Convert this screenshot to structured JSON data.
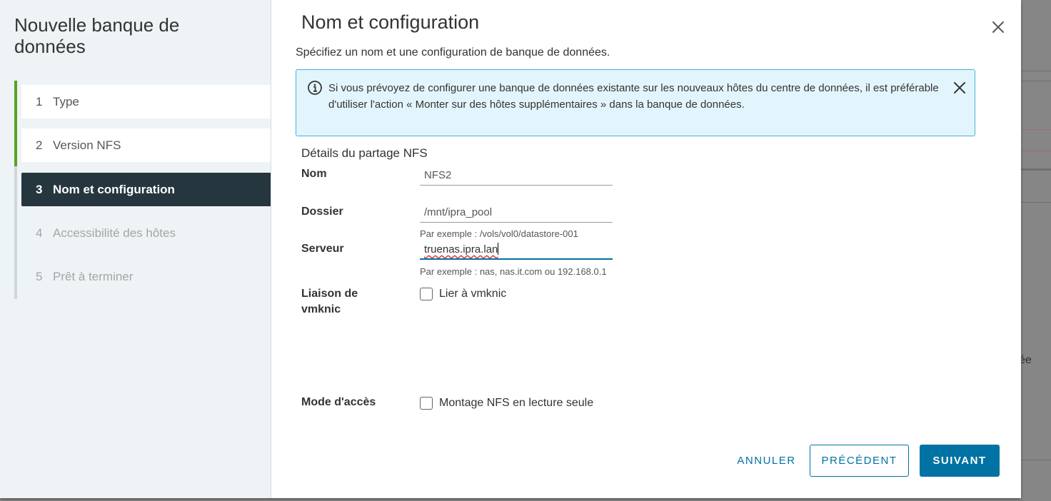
{
  "wizard": {
    "title": "Nouvelle banque de données",
    "steps": [
      {
        "num": "1",
        "label": "Type",
        "state": "done"
      },
      {
        "num": "2",
        "label": "Version NFS",
        "state": "done"
      },
      {
        "num": "3",
        "label": "Nom et configuration",
        "state": "current"
      },
      {
        "num": "4",
        "label": "Accessibilité des hôtes",
        "state": "todo"
      },
      {
        "num": "5",
        "label": "Prêt à terminer",
        "state": "todo"
      }
    ]
  },
  "main": {
    "title": "Nom et configuration",
    "subtitle": "Spécifiez un nom et une configuration de banque de données.",
    "alert": {
      "text": "Si vous prévoyez de configurer une banque de données existante sur les nouveaux hôtes du centre de données, il est préférable d'utiliser l'action « Monter sur des hôtes supplémentaires » dans la banque de données."
    },
    "section_title": "Détails du partage NFS",
    "form": {
      "name": {
        "label": "Nom",
        "value": "NFS2"
      },
      "folder": {
        "label": "Dossier",
        "value": "/mnt/ipra_pool",
        "helper": "Par exemple : /vols/vol0/datastore-001"
      },
      "server": {
        "label": "Serveur",
        "value": "truenas.ipra.lan",
        "helper": "Par exemple : nas, nas.it.com ou 192.168.0.1"
      },
      "binding": {
        "label_line1": "Liaison de",
        "label_line2": "vmknic",
        "checkbox_label": "Lier à vmknic",
        "checked": false
      },
      "access": {
        "label": "Mode d'accès",
        "checkbox_label": "Montage NFS en lecture seule",
        "checked": false
      }
    }
  },
  "footer": {
    "cancel": "ANNULER",
    "back": "PRÉCÉDENT",
    "next": "SUIVANT"
  },
  "background": {
    "partial_text": "ée"
  },
  "colors": {
    "accent": "#0072a3",
    "step_done": "#5aa220",
    "step_current_bg": "#25363f",
    "alert_bg": "#e3f5fc",
    "alert_border": "#49afd9"
  }
}
